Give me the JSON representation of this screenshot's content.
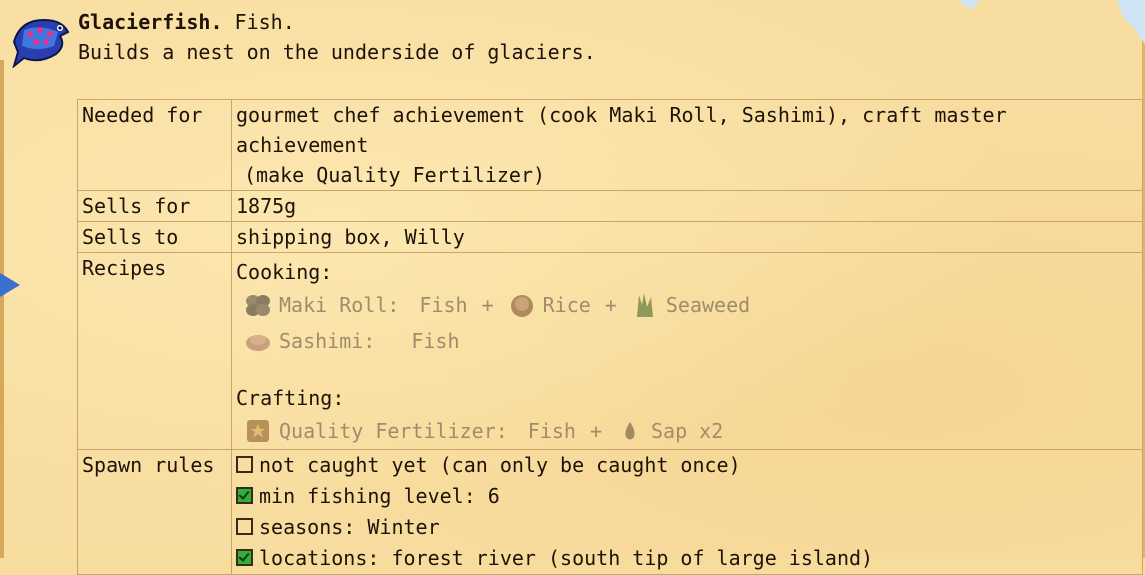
{
  "header": {
    "name": "Glacierfish.",
    "category": "Fish.",
    "description": "Builds a nest on the underside of glaciers."
  },
  "rows": {
    "needed_for": {
      "label": "Needed for",
      "line1": "gourmet chef achievement (cook Maki Roll, Sashimi), craft master achievement",
      "line2": "(make Quality Fertilizer)"
    },
    "sells_for": {
      "label": "Sells for",
      "value": "1875g"
    },
    "sells_to": {
      "label": "Sells to",
      "value": "shipping box, Willy"
    },
    "recipes": {
      "label": "Recipes",
      "cooking_label": "Cooking:",
      "maki": {
        "name": "Maki Roll:",
        "i1": "Fish",
        "plus": "+",
        "i2": "Rice",
        "i3": "Seaweed"
      },
      "sashimi": {
        "name": "Sashimi:",
        "i1": "Fish"
      },
      "crafting_label": "Crafting:",
      "fertilizer": {
        "name": "Quality Fertilizer:",
        "i1": "Fish",
        "plus": "+",
        "i2": "Sap x2"
      }
    },
    "spawn": {
      "label": "Spawn rules",
      "rules": [
        {
          "text": "not caught yet (can only be caught once)",
          "checked": false
        },
        {
          "text": "min fishing level: 6",
          "checked": true
        },
        {
          "text": "seasons: Winter",
          "checked": false
        },
        {
          "text": "locations: forest river (south tip of large island)",
          "checked": true
        }
      ]
    }
  },
  "colors": {
    "parchment": "#f8dda0",
    "checkbox_on": "#2fae3a",
    "faded_text": "#a08c6a"
  }
}
